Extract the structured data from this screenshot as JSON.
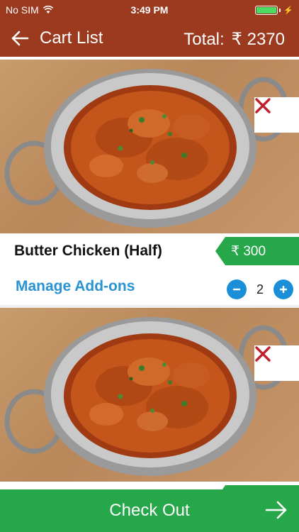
{
  "status_bar": {
    "carrier": "No SIM",
    "time": "3:49 PM",
    "battery_color": "#4cd964"
  },
  "nav": {
    "title": "Cart List",
    "total_label": "Total:",
    "total_value": "₹ 2370",
    "back_icon": "arrow-left-icon",
    "bar_color": "#9b3a1e"
  },
  "cart": {
    "items": [
      {
        "name": "Butter Chicken (Half)",
        "price": "₹ 300",
        "addons_label": "Manage Add-ons",
        "quantity": "2",
        "remove_icon": "close-icon"
      },
      {
        "name": "",
        "price": "",
        "addons_label": "",
        "quantity": "",
        "remove_icon": "close-icon"
      }
    ]
  },
  "checkout": {
    "label": "Check Out",
    "icon": "arrow-right-icon",
    "color": "#26a84a"
  },
  "colors": {
    "accent_blue": "#1a8fd6",
    "remove_red": "#c0202a",
    "price_green": "#26a84a"
  }
}
